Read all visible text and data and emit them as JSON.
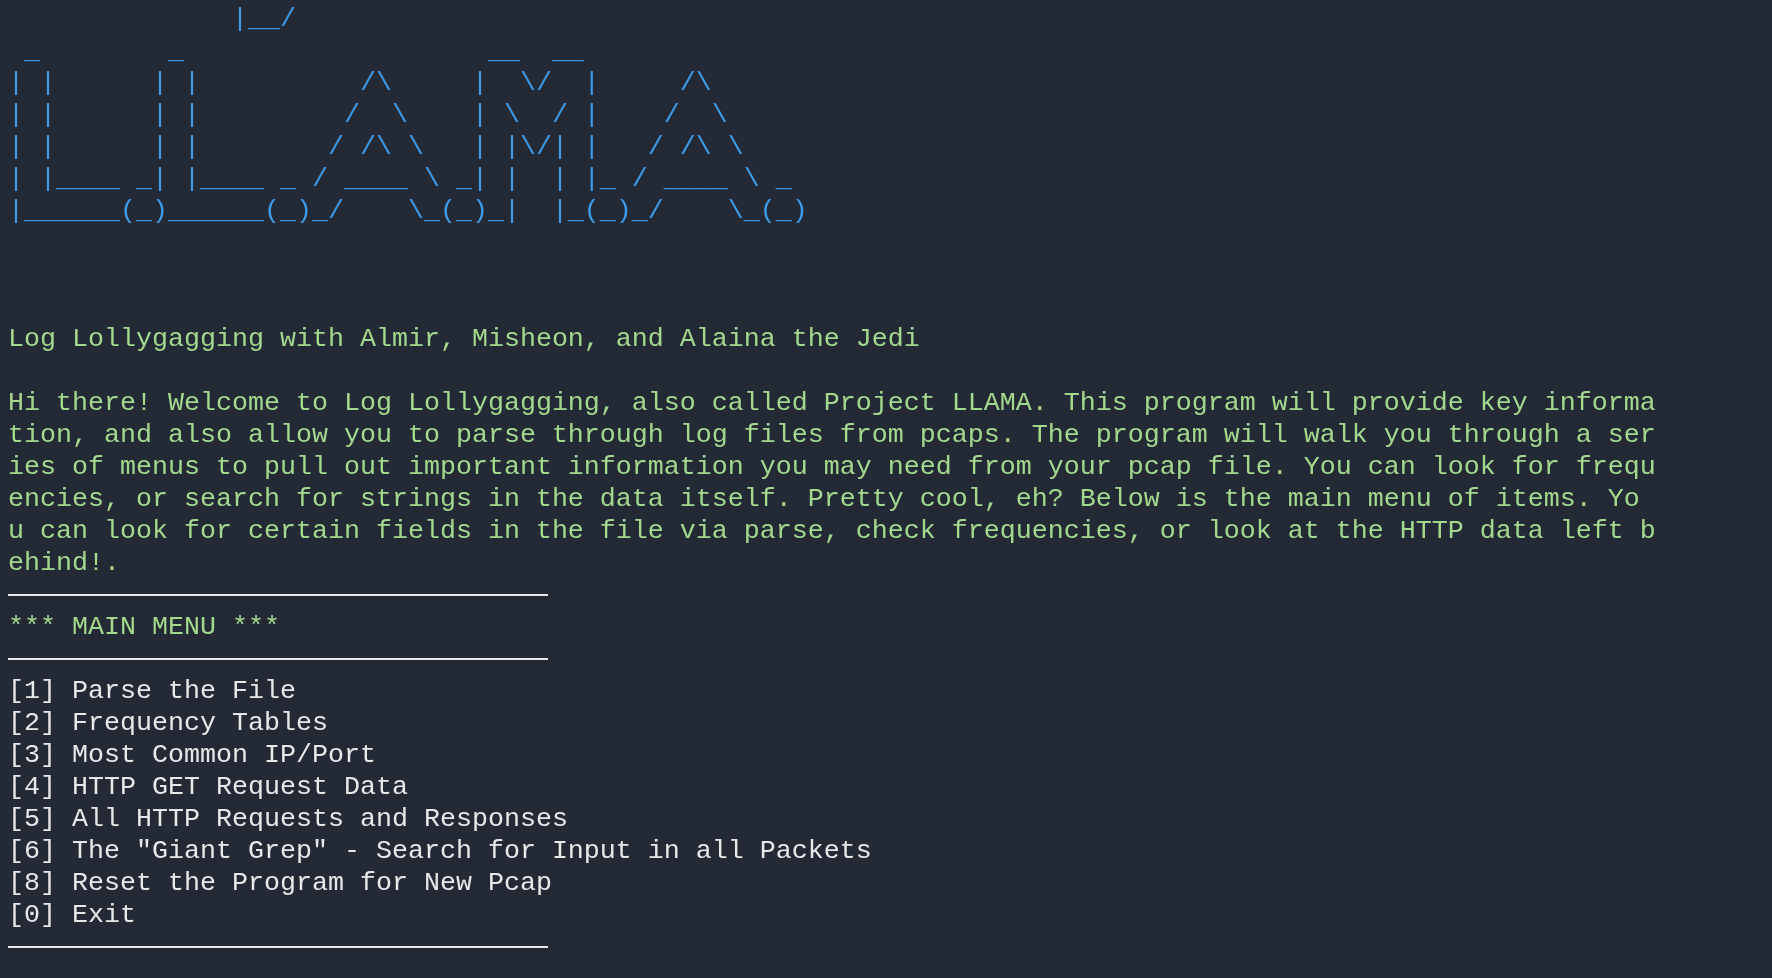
{
  "banner_art": [
    "              |__/",
    " _        _                   __  __",
    "| |      | |          /\\     |  \\/  |     /\\",
    "| |      | |         /  \\    | \\  / |    /  \\",
    "| |      | |        / /\\ \\   | |\\/| |   / /\\ \\",
    "| |____ _| |____ _ / ____ \\ _| |  | |_ / ____ \\ _",
    "|______(_)______(_)_/    \\_(_)_|  |_(_)_/    \\_(_)"
  ],
  "credits": "Log Lollygagging with Almir, Misheon, and Alaina the Jedi",
  "intro": "Hi there! Welcome to Log Lollygagging, also called Project LLAMA. This program will provide key information, and also allow you to parse through log files from pcaps. The program will walk you through a series of menus to pull out important information you may need from your pcap file. You can look for frequencies, or search for strings in the data itself. Pretty cool, eh? Below is the main menu of items. You can look for certain fields in the file via parse, check frequencies, or look at the HTTP data left behind!.",
  "menu": {
    "title": "*** MAIN MENU ***",
    "items": [
      "[1] Parse the File",
      "[2] Frequency Tables",
      "[3] Most Common IP/Port",
      "[4] HTTP GET Request Data",
      "[5] All HTTP Requests and Responses",
      "[6] The \"Giant Grep\" - Search for Input in all Packets",
      "[8] Reset the Program for New Pcap",
      "[0] Exit"
    ]
  }
}
